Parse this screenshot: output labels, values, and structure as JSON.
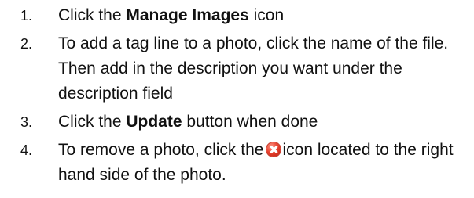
{
  "steps": [
    {
      "number": "1.",
      "text_before": "Click the ",
      "bold": "Manage Images",
      "text_after": " icon"
    },
    {
      "number": "2.",
      "text": "To add a tag line to a photo, click the name of the file. Then add in the description you want under the description field"
    },
    {
      "number": "3.",
      "text_before": "Click the ",
      "bold": "Update",
      "text_after": " button when done"
    },
    {
      "number": "4.",
      "text_before": "To remove a photo, click the",
      "icon": "remove-icon",
      "text_after": "icon located to the right hand side of the photo."
    }
  ],
  "colors": {
    "text": "#111111",
    "icon_red": "#e8412e"
  }
}
